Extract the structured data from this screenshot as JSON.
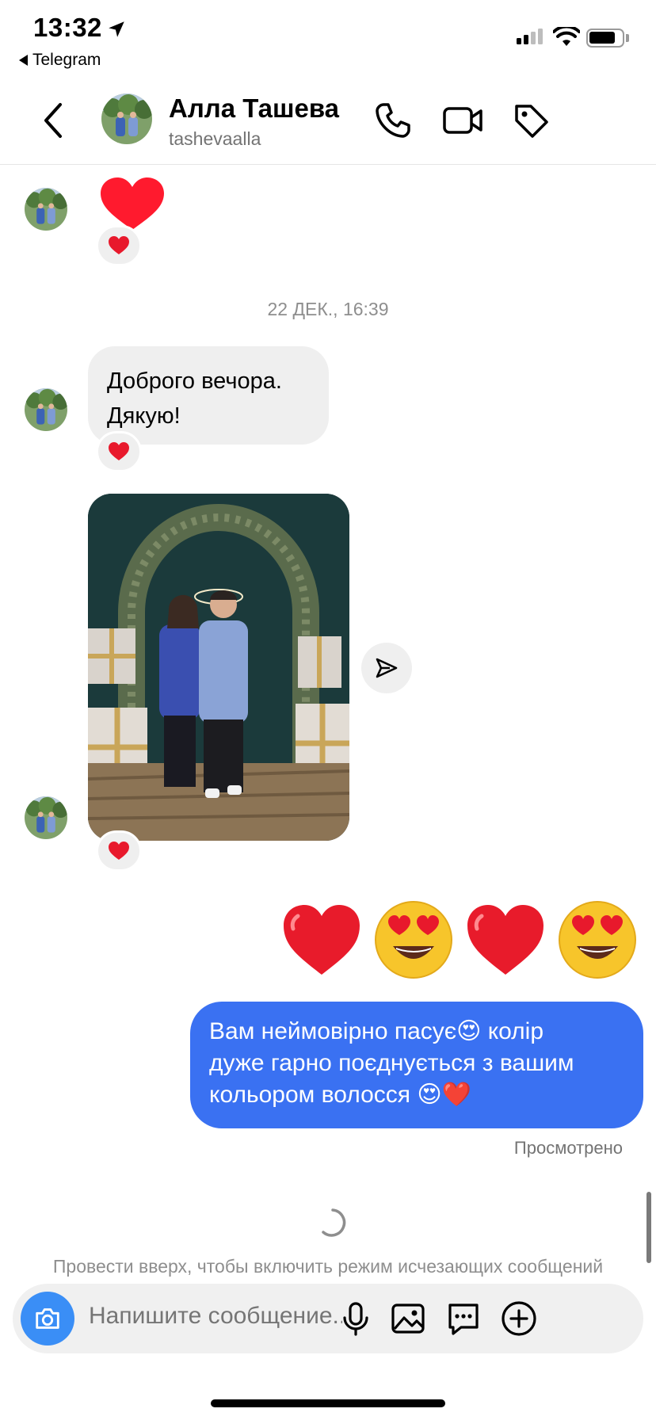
{
  "status_bar": {
    "time": "13:32",
    "back_app": "Telegram"
  },
  "header": {
    "name": "Алла Ташева",
    "username": "tashevaalla"
  },
  "messages": {
    "timestamp": "22 ДЕК., 16:39",
    "incoming_text_lines": [
      "Доброго вечора.",
      "Дякую!"
    ],
    "outgoing_text_lines": [
      "Вам неймовірно пасує😍  колір",
      "дуже гарно поєднується  з вашим",
      "кольором волосся 😍❤️"
    ],
    "seen_label": "Просмотрено",
    "reaction": "❤️"
  },
  "footer": {
    "hint": "Провести вверх, чтобы включить режим исчезающих сообщений",
    "placeholder": "Напишите сообщение..."
  },
  "colors": {
    "outgoing_bubble": "#3a71f2",
    "incoming_bubble": "#efefef",
    "camera_button": "#3a8ef6",
    "heart": "#ff1f3d"
  }
}
